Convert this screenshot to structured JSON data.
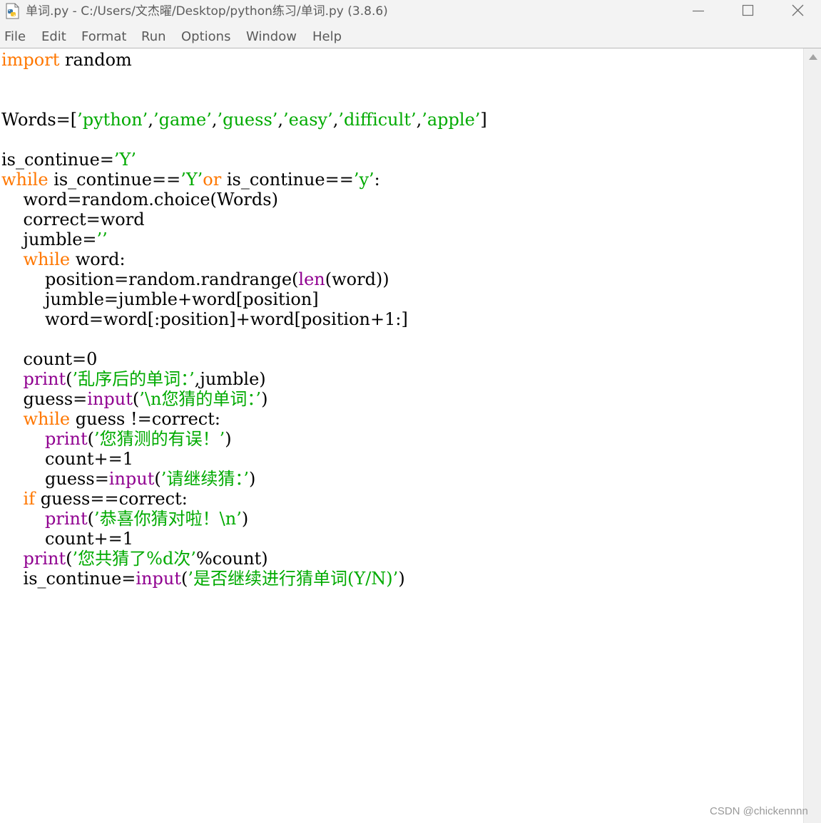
{
  "window": {
    "title": "单词.py - C:/Users/文杰曜/Desktop/python练习/单词.py (3.8.6)",
    "icon": "python-file-icon"
  },
  "window_controls": {
    "minimize_icon": "minimize-icon",
    "maximize_icon": "maximize-icon",
    "close_icon": "close-icon"
  },
  "menu": {
    "items": [
      "File",
      "Edit",
      "Format",
      "Run",
      "Options",
      "Window",
      "Help"
    ]
  },
  "colors": {
    "keyword": "#ff7700",
    "string": "#00aa00",
    "builtin": "#900090",
    "default": "#000000"
  },
  "editor": {
    "lines": [
      [
        {
          "t": "kw",
          "v": "import"
        },
        {
          "t": "n",
          "v": " random"
        }
      ],
      [],
      [],
      [
        {
          "t": "n",
          "v": "Words=["
        },
        {
          "t": "st",
          "v": "’python’"
        },
        {
          "t": "n",
          "v": ","
        },
        {
          "t": "st",
          "v": "’game’"
        },
        {
          "t": "n",
          "v": ","
        },
        {
          "t": "st",
          "v": "’guess’"
        },
        {
          "t": "n",
          "v": ","
        },
        {
          "t": "st",
          "v": "’easy’"
        },
        {
          "t": "n",
          "v": ","
        },
        {
          "t": "st",
          "v": "’difficult’"
        },
        {
          "t": "n",
          "v": ","
        },
        {
          "t": "st",
          "v": "’apple’"
        },
        {
          "t": "n",
          "v": "]"
        }
      ],
      [],
      [
        {
          "t": "n",
          "v": "is_continue="
        },
        {
          "t": "st",
          "v": "’Y’"
        }
      ],
      [
        {
          "t": "kw",
          "v": "while"
        },
        {
          "t": "n",
          "v": " is_continue=="
        },
        {
          "t": "st",
          "v": "’Y’"
        },
        {
          "t": "kw",
          "v": "or"
        },
        {
          "t": "n",
          "v": " is_continue=="
        },
        {
          "t": "st",
          "v": "’y’"
        },
        {
          "t": "n",
          "v": ":"
        }
      ],
      [
        {
          "t": "n",
          "v": "    word=random.choice(Words)"
        }
      ],
      [
        {
          "t": "n",
          "v": "    correct=word"
        }
      ],
      [
        {
          "t": "n",
          "v": "    jumble="
        },
        {
          "t": "st",
          "v": "’’"
        }
      ],
      [
        {
          "t": "n",
          "v": "    "
        },
        {
          "t": "kw",
          "v": "while"
        },
        {
          "t": "n",
          "v": " word:"
        }
      ],
      [
        {
          "t": "n",
          "v": "        position=random.randrange("
        },
        {
          "t": "bi",
          "v": "len"
        },
        {
          "t": "n",
          "v": "(word))"
        }
      ],
      [
        {
          "t": "n",
          "v": "        jumble=jumble+word[position]"
        }
      ],
      [
        {
          "t": "n",
          "v": "        word=word[:position]+word[position+1:]"
        }
      ],
      [],
      [
        {
          "t": "n",
          "v": "    count=0"
        }
      ],
      [
        {
          "t": "n",
          "v": "    "
        },
        {
          "t": "bi",
          "v": "print"
        },
        {
          "t": "n",
          "v": "("
        },
        {
          "t": "st",
          "v": "’乱序后的单词：’"
        },
        {
          "t": "n",
          "v": ",jumble)"
        }
      ],
      [
        {
          "t": "n",
          "v": "    guess="
        },
        {
          "t": "bi",
          "v": "input"
        },
        {
          "t": "n",
          "v": "("
        },
        {
          "t": "st",
          "v": "’\\n您猜的单词：’"
        },
        {
          "t": "n",
          "v": ")"
        }
      ],
      [
        {
          "t": "n",
          "v": "    "
        },
        {
          "t": "kw",
          "v": "while"
        },
        {
          "t": "n",
          "v": " guess !=correct:"
        }
      ],
      [
        {
          "t": "n",
          "v": "        "
        },
        {
          "t": "bi",
          "v": "print"
        },
        {
          "t": "n",
          "v": "("
        },
        {
          "t": "st",
          "v": "’您猜测的有误！’"
        },
        {
          "t": "n",
          "v": ")"
        }
      ],
      [
        {
          "t": "n",
          "v": "        count+=1"
        }
      ],
      [
        {
          "t": "n",
          "v": "        guess="
        },
        {
          "t": "bi",
          "v": "input"
        },
        {
          "t": "n",
          "v": "("
        },
        {
          "t": "st",
          "v": "’请继续猜：’"
        },
        {
          "t": "n",
          "v": ")"
        }
      ],
      [
        {
          "t": "n",
          "v": "    "
        },
        {
          "t": "kw",
          "v": "if"
        },
        {
          "t": "n",
          "v": " guess==correct:"
        }
      ],
      [
        {
          "t": "n",
          "v": "        "
        },
        {
          "t": "bi",
          "v": "print"
        },
        {
          "t": "n",
          "v": "("
        },
        {
          "t": "st",
          "v": "’恭喜你猜对啦！\\n’"
        },
        {
          "t": "n",
          "v": ")"
        }
      ],
      [
        {
          "t": "n",
          "v": "        count+=1"
        }
      ],
      [
        {
          "t": "n",
          "v": "    "
        },
        {
          "t": "bi",
          "v": "print"
        },
        {
          "t": "n",
          "v": "("
        },
        {
          "t": "st",
          "v": "’您共猜了%d次’"
        },
        {
          "t": "n",
          "v": "%count)"
        }
      ],
      [
        {
          "t": "n",
          "v": "    is_continue="
        },
        {
          "t": "bi",
          "v": "input"
        },
        {
          "t": "n",
          "v": "("
        },
        {
          "t": "st",
          "v": "’是否继续进行猜单词(Y/N)’"
        },
        {
          "t": "n",
          "v": ")"
        }
      ]
    ]
  },
  "scrollbar": {
    "up_arrow_icon": "scroll-up-arrow-icon"
  },
  "watermark": "CSDN @chickennnn"
}
